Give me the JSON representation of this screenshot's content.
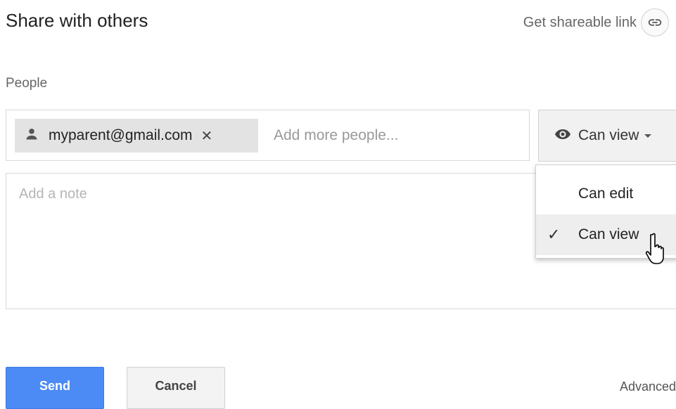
{
  "dialog": {
    "title": "Share with others",
    "shareable_link_label": "Get shareable link"
  },
  "people": {
    "label": "People",
    "chips": [
      {
        "email": "myparent@gmail.com"
      }
    ],
    "add_placeholder": "Add more people..."
  },
  "permission": {
    "current": "Can view",
    "options": [
      {
        "label": "Can edit",
        "selected": false
      },
      {
        "label": "Can view",
        "selected": true
      }
    ]
  },
  "note": {
    "placeholder": "Add a note"
  },
  "footer": {
    "send_label": "Send",
    "cancel_label": "Cancel",
    "advanced_label": "Advanced"
  },
  "colors": {
    "send_blue": "#4c8bf5",
    "chip_bg": "#e3e3e3",
    "menu_hover": "#eeeeee"
  }
}
